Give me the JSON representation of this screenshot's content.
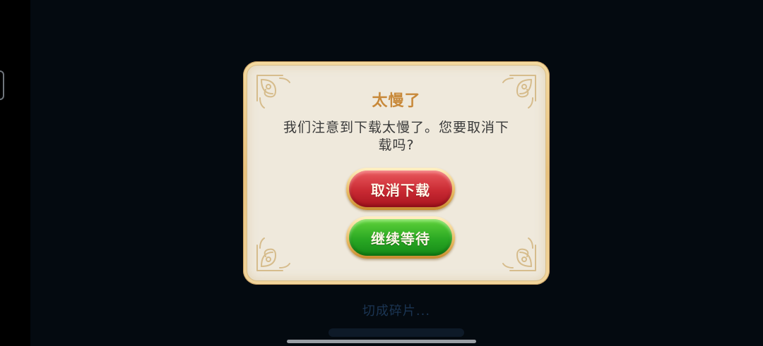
{
  "dialog": {
    "title": "太慢了",
    "message": "我们注意到下载太慢了。您要取消下载吗?",
    "cancel_label": "取消下载",
    "continue_label": "继续等待"
  },
  "background": {
    "status_text": "切成碎片..."
  },
  "colors": {
    "title": "#c8893a",
    "cancel_button": "#c92a33",
    "continue_button": "#2aa823",
    "dialog_background": "#efe9dc",
    "dialog_frame": "#e8c27e"
  }
}
